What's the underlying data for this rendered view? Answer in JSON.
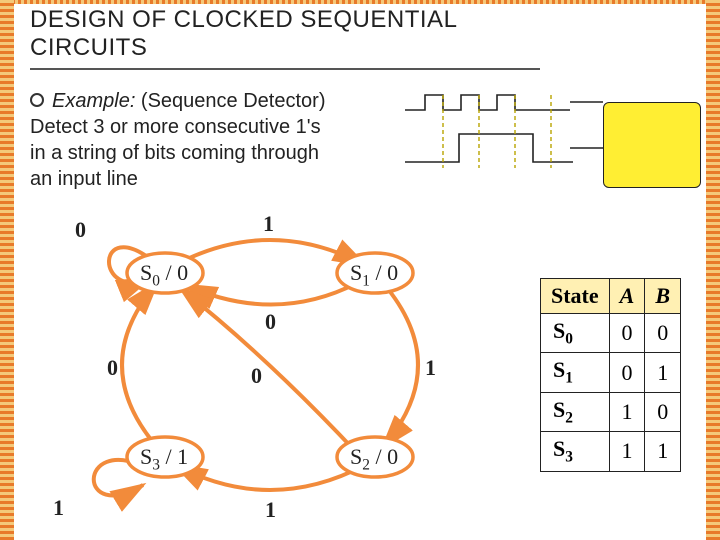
{
  "title_line1": "DESIGN OF CLOCKED SEQUENTIAL",
  "title_line2": "CIRCUITS",
  "example_label": "Example:",
  "example_rest": " (Sequence Detector)",
  "example_body1": "Detect 3 or more consecutive 1's",
  "example_body2": "in a string of bits coming through",
  "example_body3": " an input line",
  "state_labels": {
    "s0": "S",
    "s0sub": "0",
    "s0out": " / 0",
    "s1": "S",
    "s1sub": "1",
    "s1out": " / 0",
    "s2": "S",
    "s2sub": "2",
    "s2out": " / 0",
    "s3": "S",
    "s3sub": "3",
    "s3out": " / 1"
  },
  "edge_labels": {
    "s0_self": "0",
    "s0_s1": "1",
    "s1_s0": "0",
    "s1_s2": "1",
    "s2_s0": "0",
    "s2_s3": "1",
    "s3_self": "1",
    "s3_s0": "0"
  },
  "table": {
    "headers": {
      "state": "State",
      "A": "A",
      "B": "B"
    },
    "rows": [
      {
        "s": "S",
        "sub": "0",
        "a": "0",
        "b": "0"
      },
      {
        "s": "S",
        "sub": "1",
        "a": "0",
        "b": "1"
      },
      {
        "s": "S",
        "sub": "2",
        "a": "1",
        "b": "0"
      },
      {
        "s": "S",
        "sub": "3",
        "a": "1",
        "b": "1"
      }
    ]
  },
  "chart_data": {
    "type": "table",
    "title": "State encoding for sequence detector (detect ≥3 consecutive 1's)",
    "states": [
      {
        "name": "S0",
        "output": 0,
        "A": 0,
        "B": 0,
        "on0": "S0",
        "on1": "S1"
      },
      {
        "name": "S1",
        "output": 0,
        "A": 0,
        "B": 1,
        "on0": "S0",
        "on1": "S2"
      },
      {
        "name": "S2",
        "output": 0,
        "A": 1,
        "B": 0,
        "on0": "S0",
        "on1": "S3"
      },
      {
        "name": "S3",
        "output": 1,
        "A": 1,
        "B": 1,
        "on0": "S0",
        "on1": "S3"
      }
    ]
  }
}
